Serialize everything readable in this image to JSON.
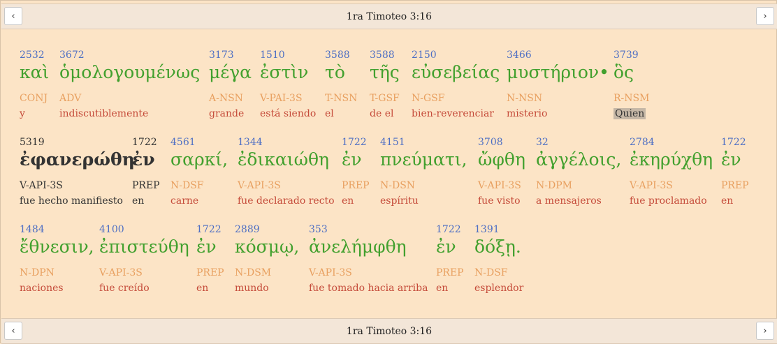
{
  "header": {
    "title": "1ra Timoteo 3:16"
  },
  "footer": {
    "title": "1ra Timoteo 3:16"
  },
  "words": [
    {
      "strong": "2532",
      "greek": "καὶ",
      "morph": "CONJ",
      "gloss": "y"
    },
    {
      "strong": "3672",
      "greek": "ὁμολογουμένως",
      "morph": "ADV",
      "gloss": "indiscutiblemente"
    },
    {
      "strong": "3173",
      "greek": "μέγα",
      "morph": "A-NSN",
      "gloss": "grande"
    },
    {
      "strong": "1510",
      "greek": "ἐστὶν",
      "morph": "V-PAI-3S",
      "gloss": "está siendo"
    },
    {
      "strong": "3588",
      "greek": "τὸ",
      "morph": "T-NSN",
      "gloss": "el"
    },
    {
      "strong": "3588",
      "greek": "τῆς",
      "morph": "T-GSF",
      "gloss": "de el"
    },
    {
      "strong": "2150",
      "greek": "εὐσεβείας",
      "morph": "N-GSF",
      "gloss": "bien-reverenciar"
    },
    {
      "strong": "3466",
      "greek": "μυστήριον•",
      "morph": "N-NSN",
      "gloss": "misterio"
    },
    {
      "strong": "3739",
      "greek": "ὃς",
      "morph": "R-NSM",
      "gloss": "Quien"
    },
    {
      "strong": "5319",
      "greek": "ἐφανερώθη",
      "morph": "V-API-3S",
      "gloss": "fue hecho manifiesto"
    },
    {
      "strong": "1722",
      "greek": "ἐν",
      "morph": "PREP",
      "gloss": "en"
    },
    {
      "strong": "4561",
      "greek": "σαρκί,",
      "morph": "N-DSF",
      "gloss": "carne"
    },
    {
      "strong": "1344",
      "greek": "ἐδικαιώθη",
      "morph": "V-API-3S",
      "gloss": "fue declarado recto"
    },
    {
      "strong": "1722",
      "greek": "ἐν",
      "morph": "PREP",
      "gloss": "en"
    },
    {
      "strong": "4151",
      "greek": "πνεύματι,",
      "morph": "N-DSN",
      "gloss": "espíritu"
    },
    {
      "strong": "3708",
      "greek": "ὤφθη",
      "morph": "V-API-3S",
      "gloss": "fue visto"
    },
    {
      "strong": "32",
      "greek": "ἀγγέλοις,",
      "morph": "N-DPM",
      "gloss": "a mensajeros"
    },
    {
      "strong": "2784",
      "greek": "ἐκηρύχθη",
      "morph": "V-API-3S",
      "gloss": "fue proclamado"
    },
    {
      "strong": "1722",
      "greek": "ἐν",
      "morph": "PREP",
      "gloss": "en"
    },
    {
      "strong": "1484",
      "greek": "ἔθνεσιν,",
      "morph": "N-DPN",
      "gloss": "naciones"
    },
    {
      "strong": "4100",
      "greek": "ἐπιστεύθη",
      "morph": "V-API-3S",
      "gloss": "fue creído"
    },
    {
      "strong": "1722",
      "greek": "ἐν",
      "morph": "PREP",
      "gloss": "en"
    },
    {
      "strong": "2889",
      "greek": "κόσμῳ,",
      "morph": "N-DSM",
      "gloss": "mundo"
    },
    {
      "strong": "353",
      "greek": "ἀνελήμφθη",
      "morph": "V-API-3S",
      "gloss": "fue tomado hacia arriba"
    },
    {
      "strong": "1722",
      "greek": "ἐν",
      "morph": "PREP",
      "gloss": "en"
    },
    {
      "strong": "1391",
      "greek": "δόξῃ.",
      "morph": "N-DSF",
      "gloss": "esplendor"
    }
  ],
  "nav": {
    "prev_icon": "chevron-left-icon",
    "next_icon": "chevron-right-icon"
  }
}
